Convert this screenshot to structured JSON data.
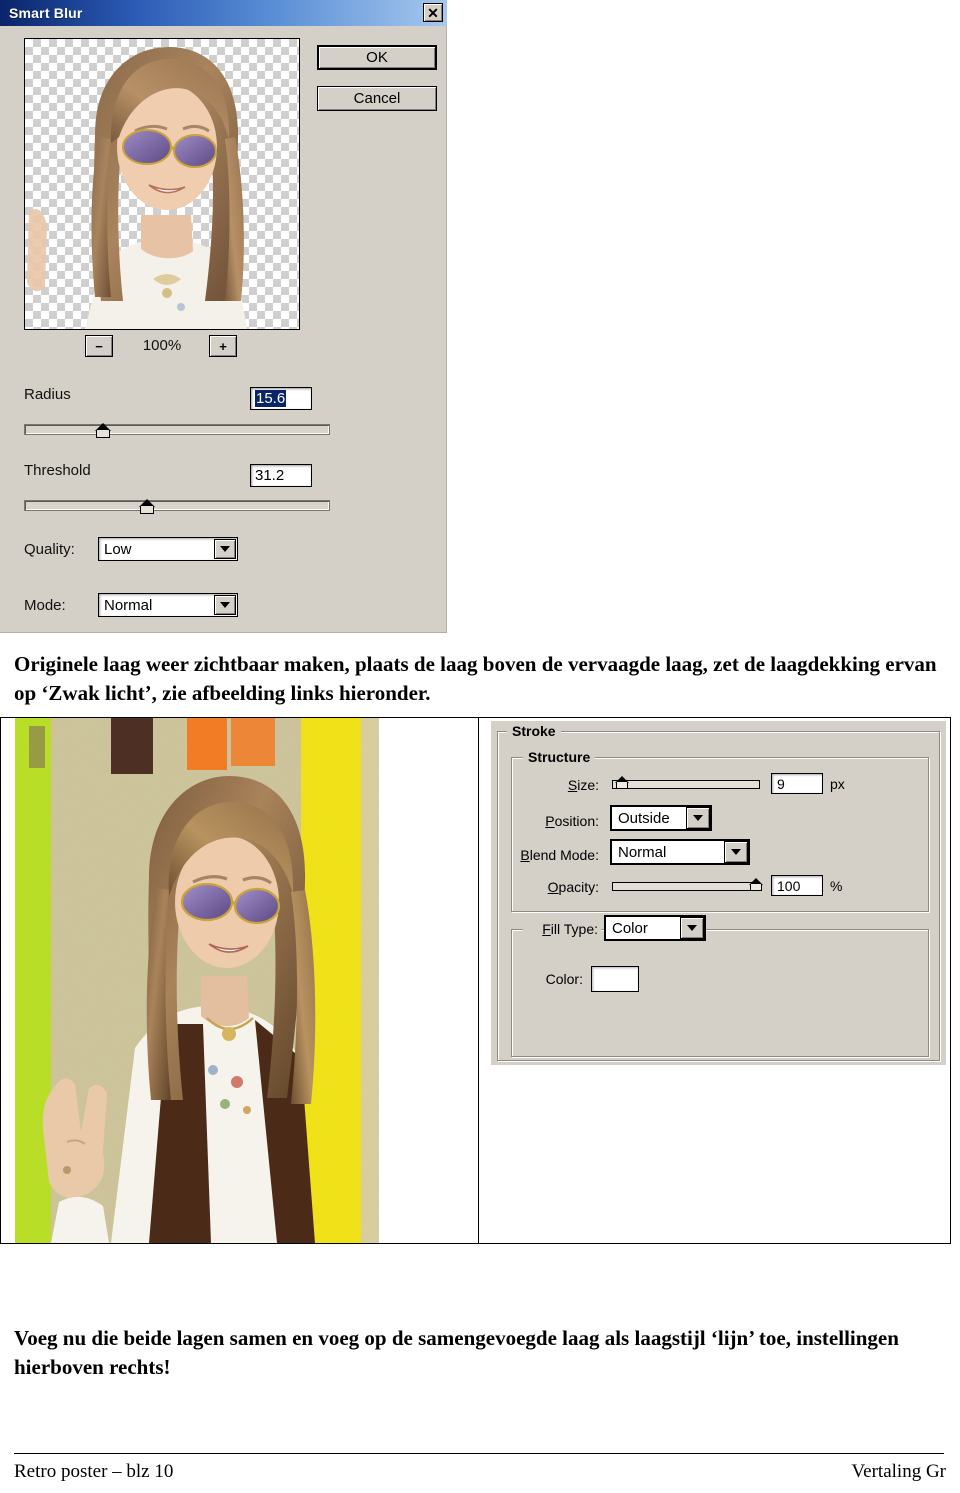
{
  "dialog": {
    "title": "Smart Blur",
    "close_label": "✕",
    "buttons": {
      "ok": "OK",
      "cancel": "Cancel"
    },
    "zoom": {
      "minus": "−",
      "plus": "+",
      "percent": "100%"
    },
    "radius": {
      "label": "Radius",
      "value": "15.6",
      "slider_pct": 16
    },
    "threshold": {
      "label": "Threshold",
      "value": "31.2",
      "slider_pct": 31
    },
    "quality": {
      "label": "Quality:",
      "value": "Low"
    },
    "mode": {
      "label": "Mode:",
      "value": "Normal"
    }
  },
  "body": {
    "paragraph_top": "Originele laag weer zichtbaar maken, plaats de laag boven de vervaagde laag, zet de laagdekking ervan op ‘Zwak licht’, zie afbeelding links hieronder.",
    "paragraph_bottom": "Voeg nu die beide lagen samen en voeg op de samengevoegde laag als laagstijl ‘lijn’ toe, instellingen hierboven rechts!"
  },
  "stroke_panel": {
    "group_title": "Stroke",
    "structure_title": "Structure",
    "size": {
      "label": "S",
      "label_rest": "ize:",
      "value": "9",
      "unit": "px",
      "slider_pct": 5
    },
    "position": {
      "label": "P",
      "label_rest": "osition:",
      "value": "Outside"
    },
    "blend_mode": {
      "label": "B",
      "label_rest": "lend Mode:",
      "value": "Normal"
    },
    "opacity": {
      "label": "O",
      "label_rest": "pacity:",
      "value": "100",
      "unit": "%",
      "slider_pct": 100
    },
    "fill_type": {
      "label": "F",
      "label_rest": "ill Type:",
      "value": "Color"
    },
    "color": {
      "label": "Color:",
      "swatch_hex": "#ffffff"
    }
  },
  "footer": {
    "left": "Retro poster – blz 10",
    "right": "Vertaling Gr"
  },
  "colors": {
    "dialog_face": "#d4d0c8",
    "titlebar_start": "#0a246a",
    "titlebar_end": "#a6c8ee",
    "selection_blue": "#0a246a",
    "poster_yellow": "#f2e312",
    "poster_green": "#b9df22",
    "poster_orange": "#f47a20",
    "poster_brown": "#4a2a1e",
    "poster_sand": "#cdc49a"
  }
}
